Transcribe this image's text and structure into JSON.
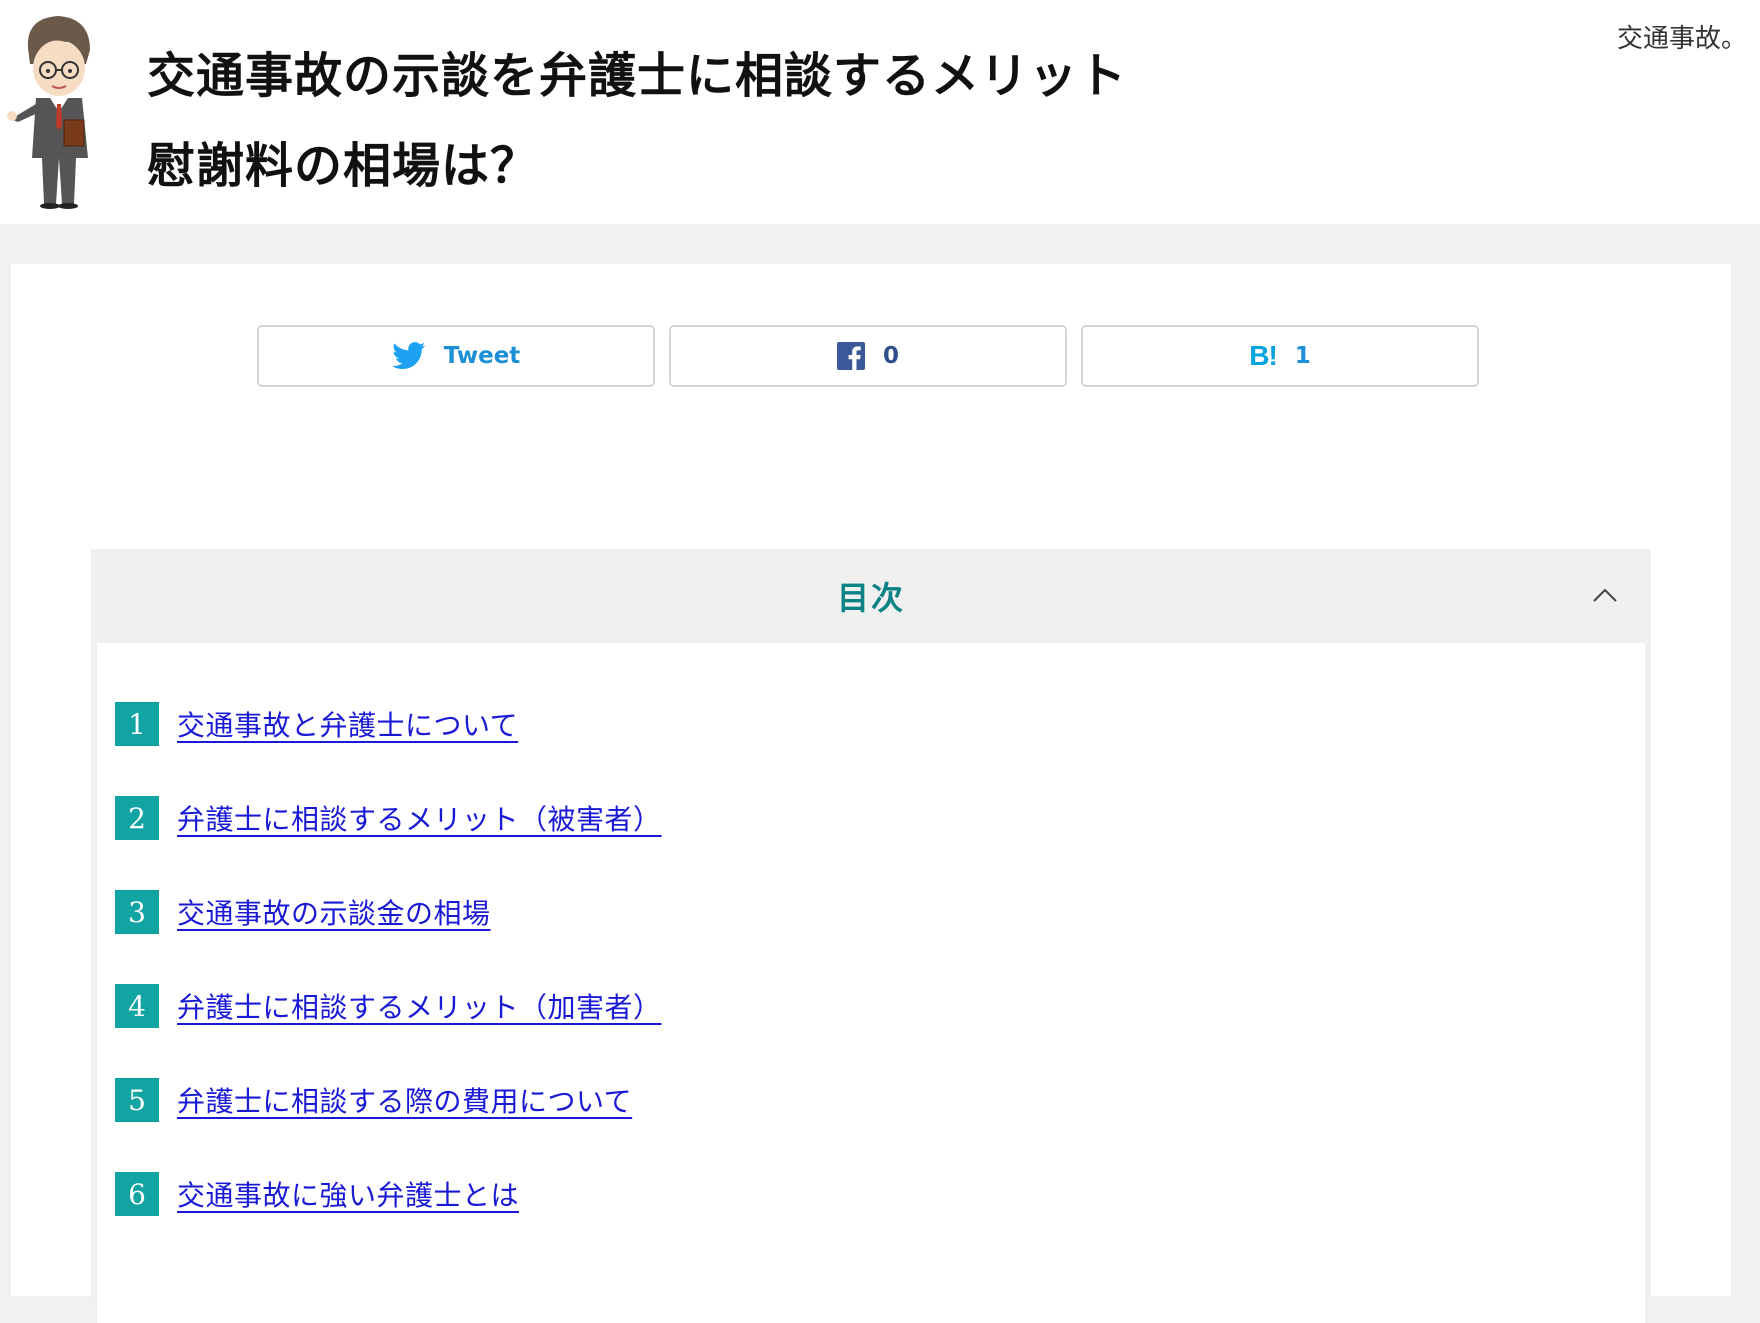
{
  "header": {
    "title_line1": "交通事故の示談を弁護士に相談するメリット",
    "title_line2": "慰謝料の相場は？",
    "excerpt": "交通事故。"
  },
  "share": {
    "tweet_label": "Tweet",
    "facebook_count": "0",
    "hatena_logo": "B!",
    "hatena_count": "1"
  },
  "toc": {
    "title": "目次",
    "items": [
      {
        "num": "1",
        "label": "交通事故と弁護士について"
      },
      {
        "num": "2",
        "label": "弁護士に相談するメリット（被害者）"
      },
      {
        "num": "3",
        "label": "交通事故の示談金の相場"
      },
      {
        "num": "4",
        "label": "弁護士に相談するメリット（加害者）"
      },
      {
        "num": "5",
        "label": "弁護士に相談する際の費用について"
      },
      {
        "num": "6",
        "label": "交通事故に強い弁護士とは"
      }
    ]
  },
  "colors": {
    "accent_teal": "#0b8285",
    "number_badge": "#12a3a3",
    "link": "#1a1ad6",
    "twitter": "#1da1f2",
    "facebook": "#3b5998",
    "hatena": "#00a4de"
  }
}
